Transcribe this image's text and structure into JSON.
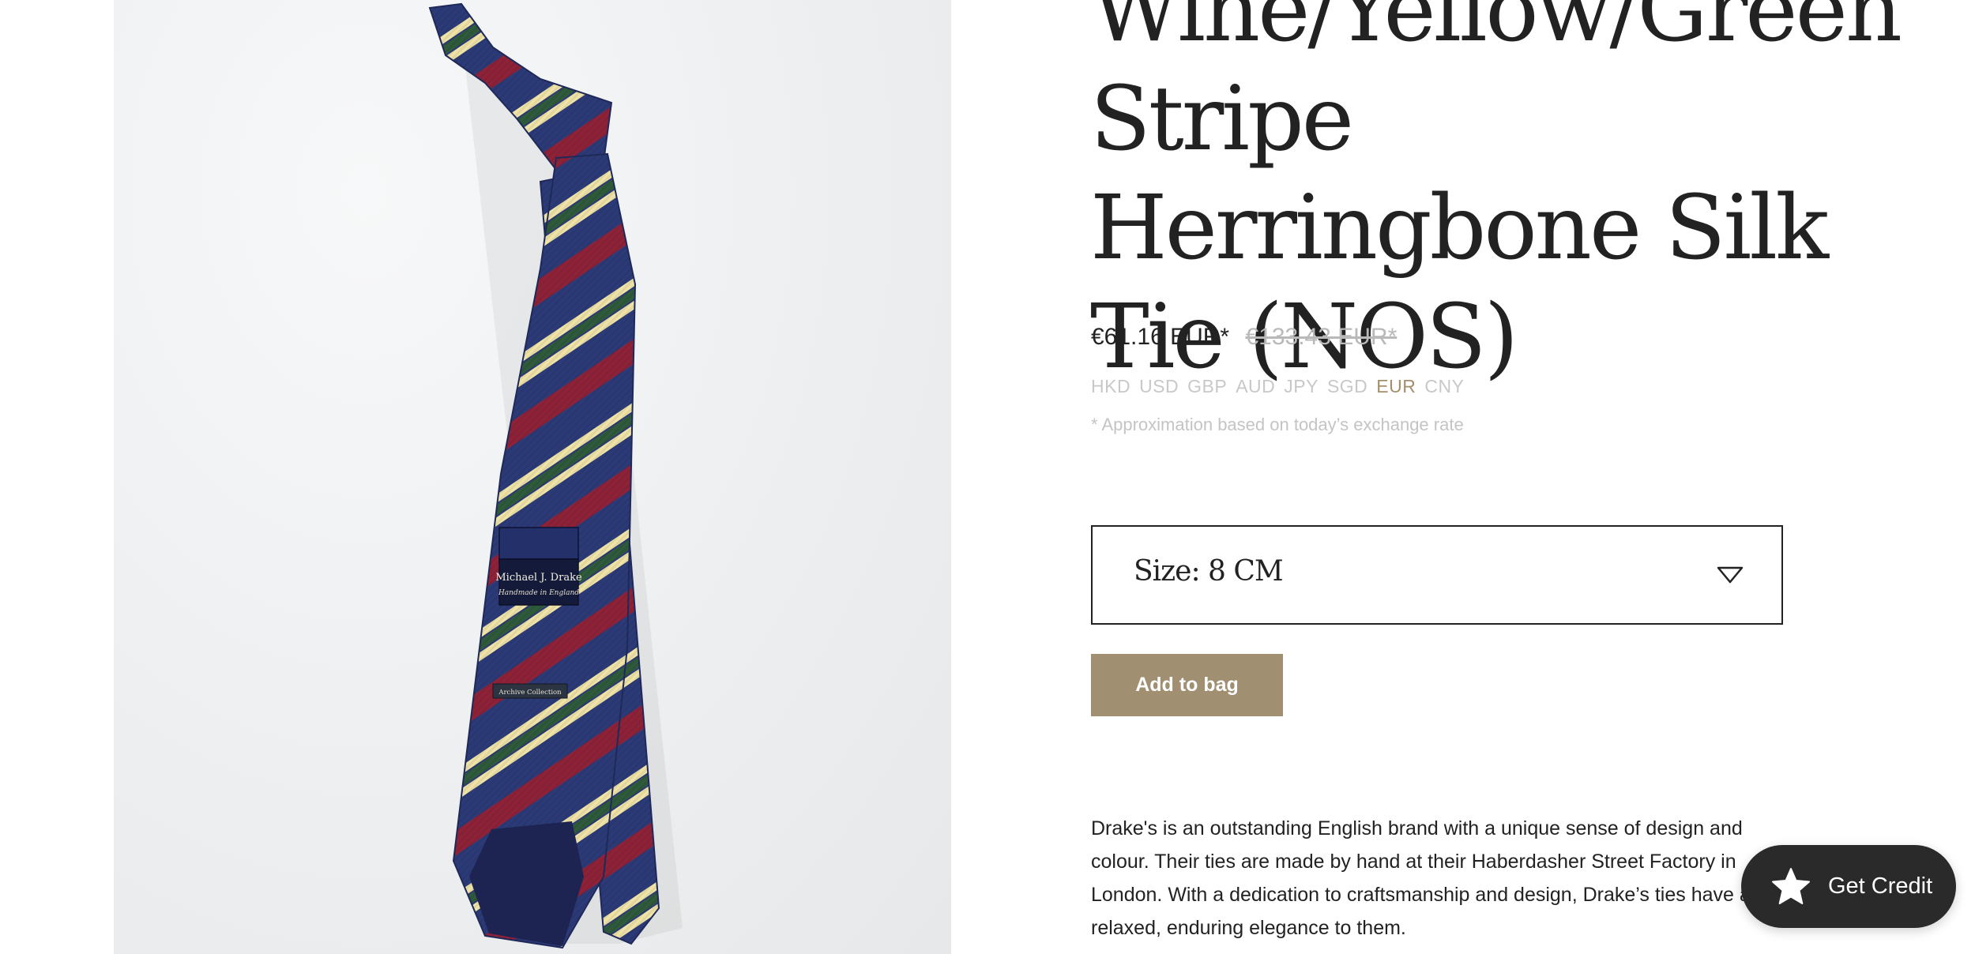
{
  "product": {
    "title": "Wine/Yellow/Green Stripe Herringbone Silk Tie (NOS)",
    "image_alt": "Navy silk tie with wine, yellow and green diagonal stripes",
    "label_main": "Michael J. Drake",
    "label_sub": "Handmade in England",
    "label_archive": "Archive Collection"
  },
  "price": {
    "current": "€61.16 EUR*",
    "original": "€133.43 EUR*"
  },
  "currencies": [
    {
      "code": "HKD",
      "active": false
    },
    {
      "code": "USD",
      "active": false
    },
    {
      "code": "GBP",
      "active": false
    },
    {
      "code": "AUD",
      "active": false
    },
    {
      "code": "JPY",
      "active": false
    },
    {
      "code": "SGD",
      "active": false
    },
    {
      "code": "EUR",
      "active": true
    },
    {
      "code": "CNY",
      "active": false
    }
  ],
  "note": "* Approximation based on today’s exchange rate",
  "size": {
    "label": "Size: 8 CM"
  },
  "actions": {
    "add_to_bag": "Add to bag",
    "get_credit": "Get Credit"
  },
  "description": "Drake's is an outstanding English brand with a unique sense of design and colour. Their ties are made by hand at their Haberdasher Street Factory in London. With a dedication to craftsmanship and design, Drake’s ties have a relaxed, enduring elegance to them.",
  "colors": {
    "accent": "#a18f72",
    "active_currency": "#a48f6c",
    "credit_button": "#2a2a2a",
    "tie_navy": "#2c3a78",
    "tie_wine": "#8e2238",
    "tie_yellow": "#efe3a8",
    "tie_green": "#2f5a3c"
  },
  "icons": {
    "dropdown": "chevron-down-icon",
    "credit": "star-icon"
  }
}
